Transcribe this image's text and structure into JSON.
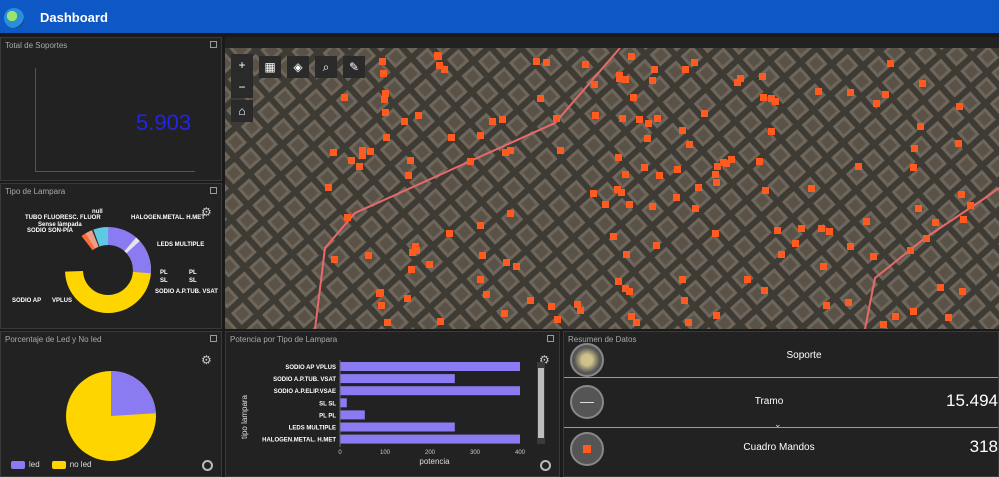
{
  "header": {
    "title": "Dashboard"
  },
  "total_soportes": {
    "title": "Total de Soportes",
    "value": "5.903"
  },
  "tipo_lampara": {
    "title": "Tipo de Lampara",
    "labels": [
      "TUBO FLUORESC. FLUOR",
      "null",
      "Sense làmpada",
      "SODIO SON-PIA",
      "HALOGEN.METAL. H.MET",
      "LEDS MULTIPLE",
      "PL",
      "PL",
      "SL",
      "SL",
      "SODIO A.P.TUB. VSAT",
      "SODIO AP",
      "VPLUS"
    ],
    "colors": {
      "sodio_ap": "#ffd500",
      "leds": "#8a7bf2",
      "halogen": "#5ec9e0",
      "sodio_vsat": "#e6e6e6",
      "fluor": "#e8a08a",
      "sodio_pia": "#ff6a3a",
      "pl": "#666666"
    }
  },
  "led_no_led": {
    "title": "Porcentaje de Led y No led",
    "legend": [
      "led",
      "no led"
    ],
    "colors": {
      "led": "#8a7bf2",
      "no_led": "#ffd500"
    },
    "led_fraction": 0.24
  },
  "potencia": {
    "title": "Potencia por Tipo de Lampara",
    "ylabel": "tipo lampara",
    "xlabel": "potencia",
    "bar_color": "#8a7bf2"
  },
  "chart_data": {
    "type": "bar",
    "categories": [
      "SODIO AP   VPLUS",
      "SODIO A.P.TUB. VSAT",
      "SODIO A.P.ELIP.VSAE",
      "SL   SL",
      "PL   PL",
      "LEDS MULTIPLE",
      "HALOGEN.METAL. H.MET"
    ],
    "values": [
      400,
      255,
      400,
      15,
      55,
      255,
      400
    ],
    "xlabel": "potencia",
    "ylabel": "tipo lampara",
    "xlim": [
      0,
      420
    ],
    "xticks": [
      "0",
      "100",
      "200",
      "300",
      "400"
    ]
  },
  "resumen": {
    "title": "Resumen de Datos",
    "rows": [
      {
        "label": "Soporte",
        "value": ""
      },
      {
        "label": "Tramo",
        "value": "15.494"
      },
      {
        "label": "Cuadro Mandos",
        "value": "318"
      }
    ]
  },
  "map": {
    "tools": [
      "+",
      "−",
      "grid-icon",
      "layers-icon",
      "search-icon",
      "measure-icon",
      "home-icon"
    ],
    "marker_color": "#ff5a1f",
    "boundary_color": "#e86a6a"
  }
}
